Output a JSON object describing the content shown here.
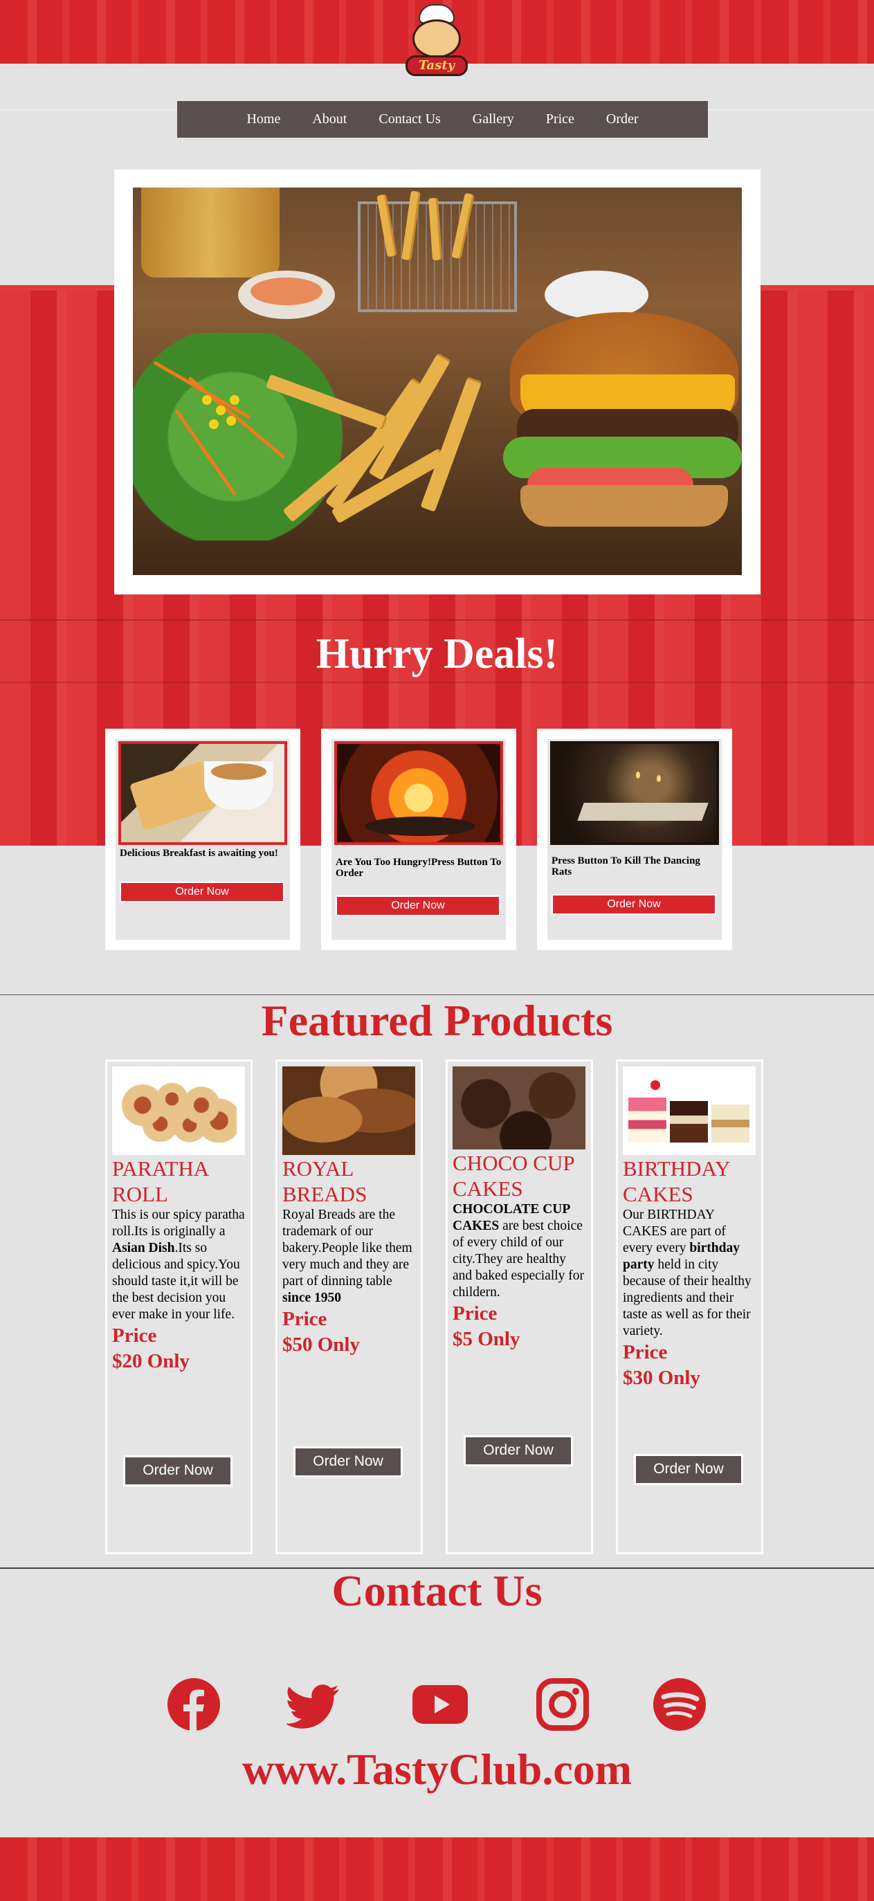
{
  "logo": {
    "text": "Tasty"
  },
  "nav": {
    "items": [
      "Home",
      "About",
      "Contact Us",
      "Gallery",
      "Price",
      "Order"
    ]
  },
  "deals": {
    "title": "Hurry Deals!",
    "cards": [
      {
        "text": "Delicious Breakfast is awaiting you!",
        "button": "Order Now"
      },
      {
        "text": "Are You Too Hungry!Press Button To Order",
        "button": "Order Now"
      },
      {
        "text": "Press Button To Kill The Dancing Rats",
        "button": "Order Now"
      }
    ]
  },
  "featured": {
    "title": "Featured Products",
    "products": [
      {
        "title": "PARATHA ROLL",
        "desc_parts": [
          "This is our spicy paratha roll.Its is originally a ",
          "Asian Dish",
          ".Its so delicious and spicy.You should taste it,it will be the best decision you ever make in your life."
        ],
        "price_label": "Price",
        "price": "$20 Only",
        "button": "Order Now"
      },
      {
        "title": "ROYAL BREADS",
        "desc_parts": [
          "Royal Breads are the trademark of our bakery.People like them very much and they are part of dinning table ",
          "since 1950",
          ""
        ],
        "price_label": "Price",
        "price": "$50 Only",
        "button": "Order Now"
      },
      {
        "title": "CHOCO CUP CAKES",
        "desc_parts": [
          "",
          "CHOCOLATE CUP CAKES",
          " are best choice of every child of our city.They are healthy and baked especially for childern."
        ],
        "price_label": "Price",
        "price": "$5 Only",
        "button": "Order Now"
      },
      {
        "title": "BIRTHDAY CAKES",
        "desc_parts": [
          "Our BIRTHDAY CAKES are part of every every ",
          "birthday party",
          " held in city because of their healthy ingredients and their taste as well as for their variety."
        ],
        "price_label": "Price",
        "price": "$30 Only",
        "button": "Order Now"
      }
    ]
  },
  "contact": {
    "title": "Contact Us",
    "socials": [
      "facebook-icon",
      "twitter-icon",
      "youtube-icon",
      "instagram-icon",
      "spotify-icon"
    ],
    "website": "www.TastyClub.com"
  },
  "colors": {
    "brand_red": "#d7262b",
    "nav_bg": "#594f4e",
    "page_bg": "#e3e3e3"
  }
}
